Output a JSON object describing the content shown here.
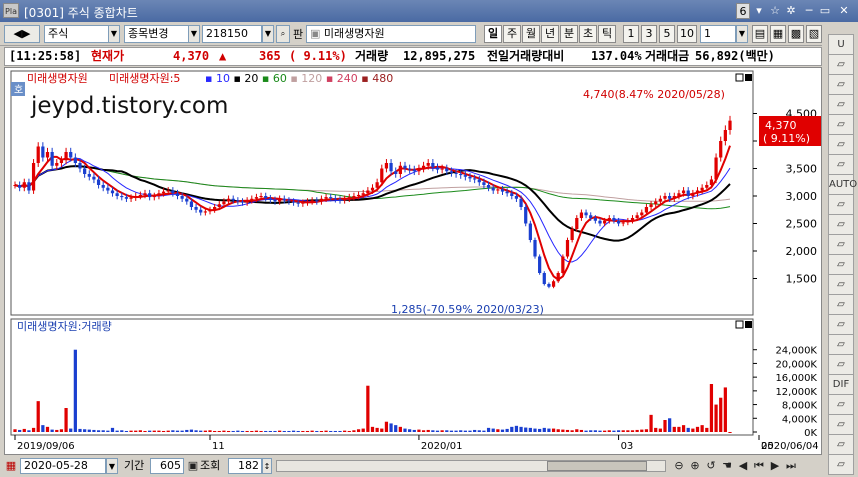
{
  "window": {
    "logo": "Pla",
    "title": "[0301] 주식 종합차트",
    "page_no": "6",
    "controls": [
      "▾",
      "☆",
      "✲",
      "─",
      "▭",
      "✕"
    ]
  },
  "toolbar": {
    "nav_arrows": "◀▶",
    "market": "주식",
    "mode": "종목변경",
    "code": "218150",
    "search_label": "판",
    "stock_name": "미래생명자원",
    "periods": [
      "일",
      "주",
      "월",
      "년",
      "분",
      "초",
      "틱"
    ],
    "minutes": [
      "1",
      "3",
      "5",
      "10"
    ],
    "interval_value": "1"
  },
  "info": {
    "time": "[11:25:58]",
    "price_label": "현재가",
    "price": "4,370",
    "arrow": "▲",
    "change": "365",
    "change_pct": "( 9.11%)",
    "volume_label": "거래량",
    "volume": "12,895,275",
    "prev_ratio_label": "전일거래량대비",
    "prev_ratio": "137.04%",
    "amount_label": "거래대금",
    "amount": "56,892(백만)"
  },
  "chart_legend": {
    "badge": "호",
    "name": "미래생명자원",
    "ma_name": "미래생명자원:5",
    "ma_items": [
      {
        "label": "10",
        "color": "#2828ff"
      },
      {
        "label": "20",
        "color": "#000000"
      },
      {
        "label": "60",
        "color": "#1a8a1a"
      },
      {
        "label": "120",
        "color": "#c0a0a0"
      },
      {
        "label": "240",
        "color": "#d04060"
      },
      {
        "label": "480",
        "color": "#9b2020"
      }
    ],
    "watermark": "jeypd.tistory.com"
  },
  "volume_legend": "미래생명자원:거래량",
  "chart_data": {
    "type": "candlestick",
    "price_ticks": [
      "4,500",
      "4,000",
      "3,500",
      "3,000",
      "2,500",
      "2,000",
      "1,500"
    ],
    "price_tick_values": [
      4500,
      4000,
      3500,
      3000,
      2500,
      2000,
      1500
    ],
    "ylim": [
      1000,
      5000
    ],
    "volume_ticks": [
      "24,000K",
      "20,000K",
      "16,000K",
      "12,000K",
      "8,000K",
      "4,000K",
      "0K"
    ],
    "volume_tick_values": [
      24000,
      20000,
      16000,
      12000,
      8000,
      4000,
      0
    ],
    "volume_ylim": [
      0,
      28000
    ],
    "x_labels": [
      "2019/09/06",
      "11",
      "2020/01",
      "03",
      "05",
      "2020/06/04"
    ],
    "x_label_index": [
      0,
      42,
      87,
      130,
      172,
      200
    ],
    "high_annotation": "4,740(8.47% 2020/05/28)",
    "low_annotation": "1,285(-70.59% 2020/03/23)",
    "current_price_box": [
      "4,370",
      "( 9.11%)"
    ],
    "closes": [
      3200,
      3150,
      3250,
      3100,
      3600,
      3900,
      3700,
      3800,
      3550,
      3600,
      3650,
      3800,
      3700,
      3600,
      3500,
      3400,
      3350,
      3300,
      3200,
      3150,
      3100,
      3050,
      3000,
      2980,
      2950,
      2970,
      3000,
      3020,
      3050,
      2980,
      3000,
      3050,
      3080,
      3100,
      3050,
      3000,
      2950,
      2900,
      2800,
      2750,
      2700,
      2720,
      2750,
      2800,
      2850,
      2900,
      2950,
      2920,
      2900,
      2880,
      2920,
      2950,
      2980,
      3000,
      2960,
      2930,
      2900,
      2950,
      2920,
      2900,
      2880,
      2860,
      2880,
      2900,
      2920,
      2900,
      2950,
      2980,
      2960,
      2940,
      2920,
      2950,
      2980,
      3000,
      3020,
      3050,
      3100,
      3150,
      3250,
      3500,
      3600,
      3450,
      3400,
      3550,
      3500,
      3480,
      3450,
      3500,
      3550,
      3600,
      3520,
      3480,
      3500,
      3450,
      3420,
      3400,
      3380,
      3350,
      3320,
      3300,
      3250,
      3200,
      3150,
      3100,
      3120,
      3080,
      3050,
      3000,
      2950,
      2800,
      2500,
      2200,
      1900,
      1600,
      1400,
      1350,
      1450,
      1600,
      1900,
      2200,
      2400,
      2600,
      2700,
      2650,
      2600,
      2550,
      2500,
      2550,
      2600,
      2550,
      2500,
      2520,
      2550,
      2600,
      2650,
      2700,
      2800,
      2850,
      2900,
      2950,
      3000,
      2950,
      3000,
      3050,
      3100,
      3000,
      3050,
      3100,
      3150,
      3200,
      3300,
      3700,
      4000,
      4200,
      4370
    ],
    "volume": [
      800,
      600,
      900,
      500,
      1200,
      9000,
      2000,
      1500,
      700,
      600,
      800,
      7000,
      1000,
      24000,
      900,
      800,
      700,
      600,
      500,
      500,
      400,
      1200,
      400,
      500,
      300,
      400,
      400,
      500,
      300,
      400,
      400,
      400,
      300,
      400,
      500,
      400,
      400,
      600,
      700,
      500,
      400,
      400,
      500,
      300,
      300,
      400,
      300,
      300,
      400,
      300,
      300,
      300,
      400,
      300,
      300,
      300,
      300,
      400,
      300,
      300,
      400,
      300,
      300,
      300,
      400,
      300,
      300,
      400,
      300,
      300,
      300,
      400,
      300,
      500,
      800,
      1000,
      13500,
      1500,
      1200,
      1000,
      3000,
      2500,
      2000,
      1500,
      1000,
      800,
      600,
      700,
      500,
      600,
      500,
      400,
      500,
      500,
      400,
      400,
      500,
      400,
      400,
      600,
      500,
      400,
      1200,
      1000,
      800,
      700,
      900,
      1500,
      1800,
      1500,
      1300,
      1200,
      1000,
      900,
      1200,
      1000,
      1000,
      800,
      700,
      600,
      500,
      800,
      600,
      400,
      500,
      500,
      400,
      400,
      500,
      400,
      500,
      500,
      500,
      500,
      600,
      700,
      800,
      5000,
      1200,
      1000,
      3500,
      4000,
      1500,
      1500,
      2000,
      1200,
      1000,
      1500,
      2000,
      1200,
      14000,
      8000,
      10000,
      13000
    ]
  },
  "bottom": {
    "date": "2020-05-28",
    "period_label": "기간",
    "period_value": "605",
    "query_label": "조회",
    "query_value": "182"
  },
  "sidebar": {
    "buttons": [
      "U",
      "",
      "",
      "",
      "",
      "",
      "",
      "AUTO",
      "",
      "",
      "",
      "",
      "",
      "",
      "",
      "",
      "",
      "DIF",
      "",
      "",
      "",
      ""
    ]
  }
}
